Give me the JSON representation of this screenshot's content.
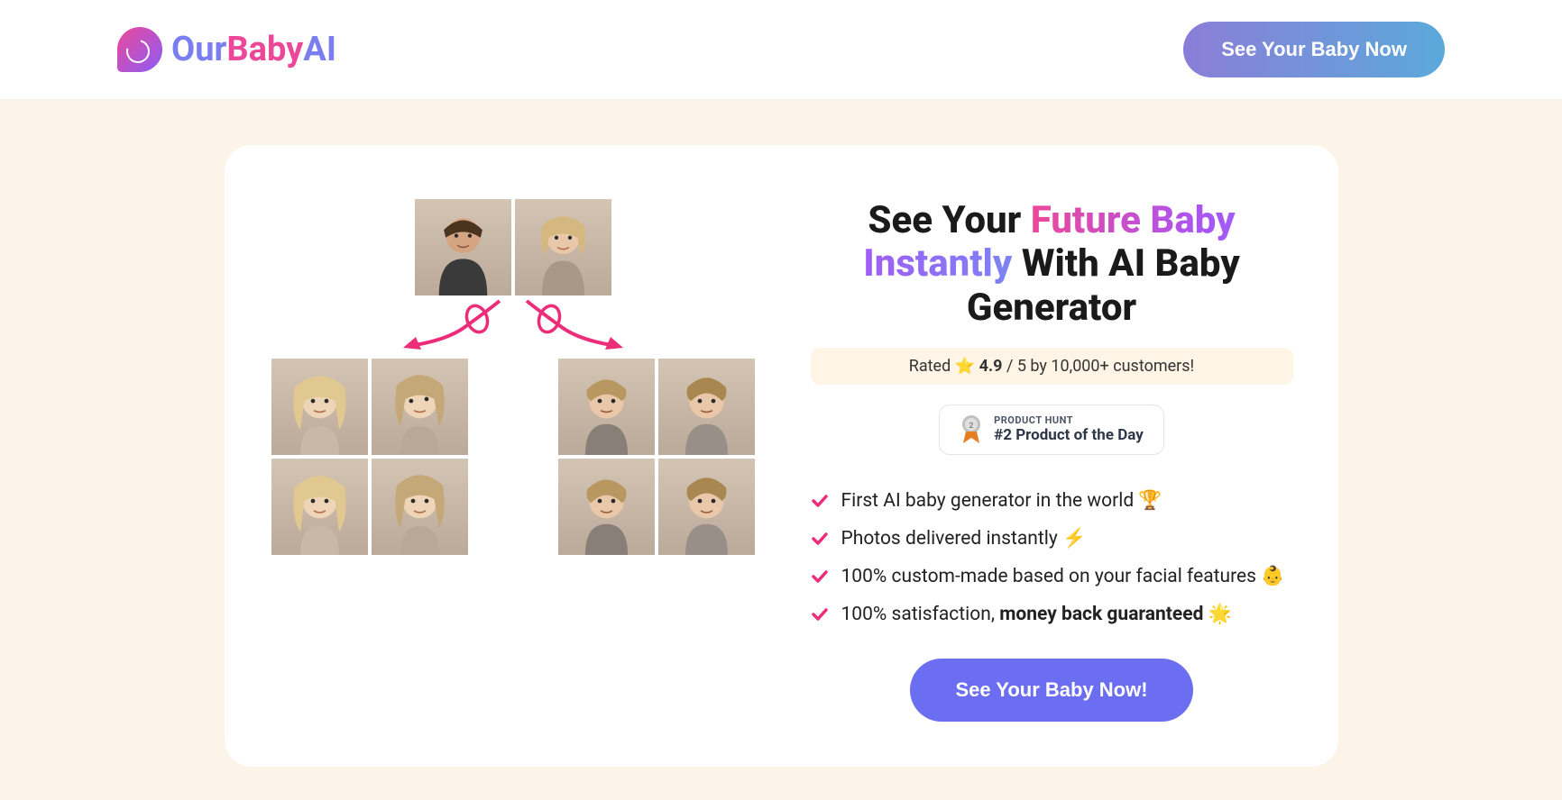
{
  "header": {
    "logo": {
      "part1": "Our",
      "part2": "Baby",
      "part3": "AI"
    },
    "cta": "See Your Baby Now"
  },
  "hero": {
    "headline_part1": "See Your ",
    "headline_gradient": "Future Baby Instantly",
    "headline_part2": " With AI Baby Generator",
    "rating": {
      "prefix": "Rated ",
      "star": "⭐",
      "score": "4.9",
      "suffix": " / 5 by 10,000+ customers!"
    },
    "badge": {
      "label": "PRODUCT HUNT",
      "title": "#2 Product of the Day"
    },
    "features": [
      {
        "text": "First AI baby generator in the world ",
        "emoji": "🏆",
        "bold": false
      },
      {
        "text": "Photos delivered instantly ",
        "emoji": "⚡",
        "bold": false
      },
      {
        "text": "100% custom-made based on your facial features ",
        "emoji": "👶",
        "bold": false
      },
      {
        "text_prefix": "100% satisfaction, ",
        "text_bold": "money back guaranteed",
        "emoji": " 🌟",
        "bold": true
      }
    ],
    "cta": "See Your Baby Now!"
  }
}
